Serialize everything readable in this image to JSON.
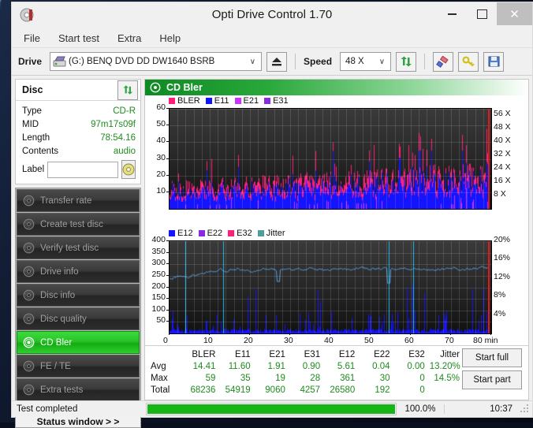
{
  "window": {
    "title": "Opti Drive Control 1.70",
    "app_icon": "optical-disc-icon",
    "minimize": "–",
    "maximize": "□",
    "close": "✕"
  },
  "menu": {
    "items": [
      "File",
      "Start test",
      "Extra",
      "Help"
    ]
  },
  "toolbar": {
    "drive_label": "Drive",
    "drive_value": "(G:)   BENQ DVD DD DW1640 BSRB",
    "eject_icon": "eject-icon",
    "speed_label": "Speed",
    "speed_value": "48 X",
    "refresh_icon": "refresh-arrows-icon",
    "eraser_icon": "eraser-icon",
    "key_icon": "key-icon",
    "save_icon": "save-disk-icon",
    "caret": "∨"
  },
  "disc": {
    "header": "Disc",
    "refresh_icon": "refresh-arrows-icon",
    "rows": [
      {
        "key": "Type",
        "value": "CD-R"
      },
      {
        "key": "MID",
        "value": "97m17s09f"
      },
      {
        "key": "Length",
        "value": "78:54.16"
      },
      {
        "key": "Contents",
        "value": "audio"
      }
    ],
    "label_key": "Label",
    "label_value": "",
    "label_placeholder": "",
    "cd_icon": "cd-disc-icon"
  },
  "nav": {
    "items": [
      {
        "label": "Transfer rate",
        "icon": "disc-icon",
        "active": false
      },
      {
        "label": "Create test disc",
        "icon": "disc-icon",
        "active": false
      },
      {
        "label": "Verify test disc",
        "icon": "disc-icon",
        "active": false
      },
      {
        "label": "Drive info",
        "icon": "disc-icon",
        "active": false
      },
      {
        "label": "Disc info",
        "icon": "disc-icon",
        "active": false
      },
      {
        "label": "Disc quality",
        "icon": "disc-icon",
        "active": false
      },
      {
        "label": "CD Bler",
        "icon": "disc-icon",
        "active": true
      },
      {
        "label": "FE / TE",
        "icon": "disc-icon",
        "active": false
      },
      {
        "label": "Extra tests",
        "icon": "disc-icon",
        "active": false
      }
    ],
    "status_window": "Status window > >"
  },
  "panel": {
    "title": "CD Bler",
    "icon": "disc-icon"
  },
  "chart_data": [
    {
      "type": "area",
      "title": "CD Bler - error rates",
      "xlabel": "min",
      "ylabel": "",
      "x": [
        0,
        80
      ],
      "xticks": [
        0,
        10,
        20,
        30,
        40,
        50,
        60,
        70,
        80
      ],
      "xtick_labels": [
        "0",
        "10",
        "20",
        "30",
        "40",
        "50",
        "60",
        "70",
        "80 min"
      ],
      "ylim": [
        0,
        60
      ],
      "yticks": [
        10,
        20,
        30,
        40,
        50,
        60
      ],
      "ytick_labels": [
        "10",
        "20",
        "30",
        "40",
        "50",
        "60"
      ],
      "y2lim": [
        0,
        60
      ],
      "y2ticks": [
        8,
        16,
        24,
        32,
        40,
        48,
        56
      ],
      "y2tick_labels": [
        "8 X",
        "16 X",
        "24 X",
        "32 X",
        "40 X",
        "48 X",
        "56 X"
      ],
      "grid": true,
      "legend": [
        {
          "name": "BLER",
          "color": "#ff1f7a"
        },
        {
          "name": "E11",
          "color": "#1414ff"
        },
        {
          "name": "E21",
          "color": "#cc33ff"
        },
        {
          "name": "E31",
          "color": "#8a2be2"
        }
      ],
      "series": [
        {
          "name": "BLER",
          "color": "#ff1f7a",
          "avg": 14.41,
          "max": 59,
          "total": 68236
        },
        {
          "name": "E11",
          "color": "#1414ff",
          "avg": 11.6,
          "max": 35,
          "total": 54919
        },
        {
          "name": "E21",
          "color": "#cc33ff",
          "avg": 1.91,
          "max": 19,
          "total": 9060
        },
        {
          "name": "E31",
          "color": "#8a2be2",
          "avg": 0.9,
          "max": 28,
          "total": 4257
        }
      ],
      "read_speed_end": 48
    },
    {
      "type": "line",
      "title": "CD Bler - E12/E22/E32 and Jitter",
      "xlabel": "min",
      "x": [
        0,
        80
      ],
      "xticks": [
        0,
        10,
        20,
        30,
        40,
        50,
        60,
        70,
        80
      ],
      "xtick_labels": [
        "0",
        "10",
        "20",
        "30",
        "40",
        "50",
        "60",
        "70",
        "80 min"
      ],
      "ylim": [
        0,
        400
      ],
      "yticks": [
        50,
        100,
        150,
        200,
        250,
        300,
        350,
        400
      ],
      "ytick_labels": [
        "50",
        "100",
        "150",
        "200",
        "250",
        "300",
        "350",
        "400"
      ],
      "y2lim": [
        0,
        20
      ],
      "y2ticks": [
        4,
        8,
        12,
        16,
        20
      ],
      "y2tick_labels": [
        "4%",
        "8%",
        "12%",
        "16%",
        "20%"
      ],
      "grid": true,
      "legend": [
        {
          "name": "E12",
          "color": "#1414ff"
        },
        {
          "name": "E22",
          "color": "#8a2be2"
        },
        {
          "name": "E32",
          "color": "#ff1f7a"
        },
        {
          "name": "Jitter",
          "color": "#4f9e9e"
        }
      ],
      "series": [
        {
          "name": "E12",
          "color": "#1414ff",
          "avg": 5.61,
          "max": 361,
          "total": 26580
        },
        {
          "name": "E22",
          "color": "#8a2be2",
          "avg": 0.04,
          "max": 30,
          "total": 192
        },
        {
          "name": "E32",
          "color": "#ff1f7a",
          "avg": 0.0,
          "max": 0,
          "total": 0
        },
        {
          "name": "Jitter",
          "color": "#5aa7e8",
          "avg": 13.2,
          "max": 14.5,
          "unit": "%"
        }
      ],
      "jitter_level_approx": 270
    }
  ],
  "stats": {
    "columns": [
      "BLER",
      "E11",
      "E21",
      "E31",
      "E12",
      "E22",
      "E32",
      "Jitter"
    ],
    "rows": [
      {
        "label": "Avg",
        "values": [
          "14.41",
          "11.60",
          "1.91",
          "0.90",
          "5.61",
          "0.04",
          "0.00",
          "13.20%"
        ]
      },
      {
        "label": "Max",
        "values": [
          "59",
          "35",
          "19",
          "28",
          "361",
          "30",
          "0",
          "14.5%"
        ]
      },
      {
        "label": "Total",
        "values": [
          "68236",
          "54919",
          "9060",
          "4257",
          "26580",
          "192",
          "0",
          ""
        ]
      }
    ],
    "start_full": "Start full",
    "start_part": "Start part"
  },
  "statusbar": {
    "message": "Test completed",
    "progress_pct": "100.0%",
    "progress_value": 100,
    "elapsed": "10:37"
  }
}
